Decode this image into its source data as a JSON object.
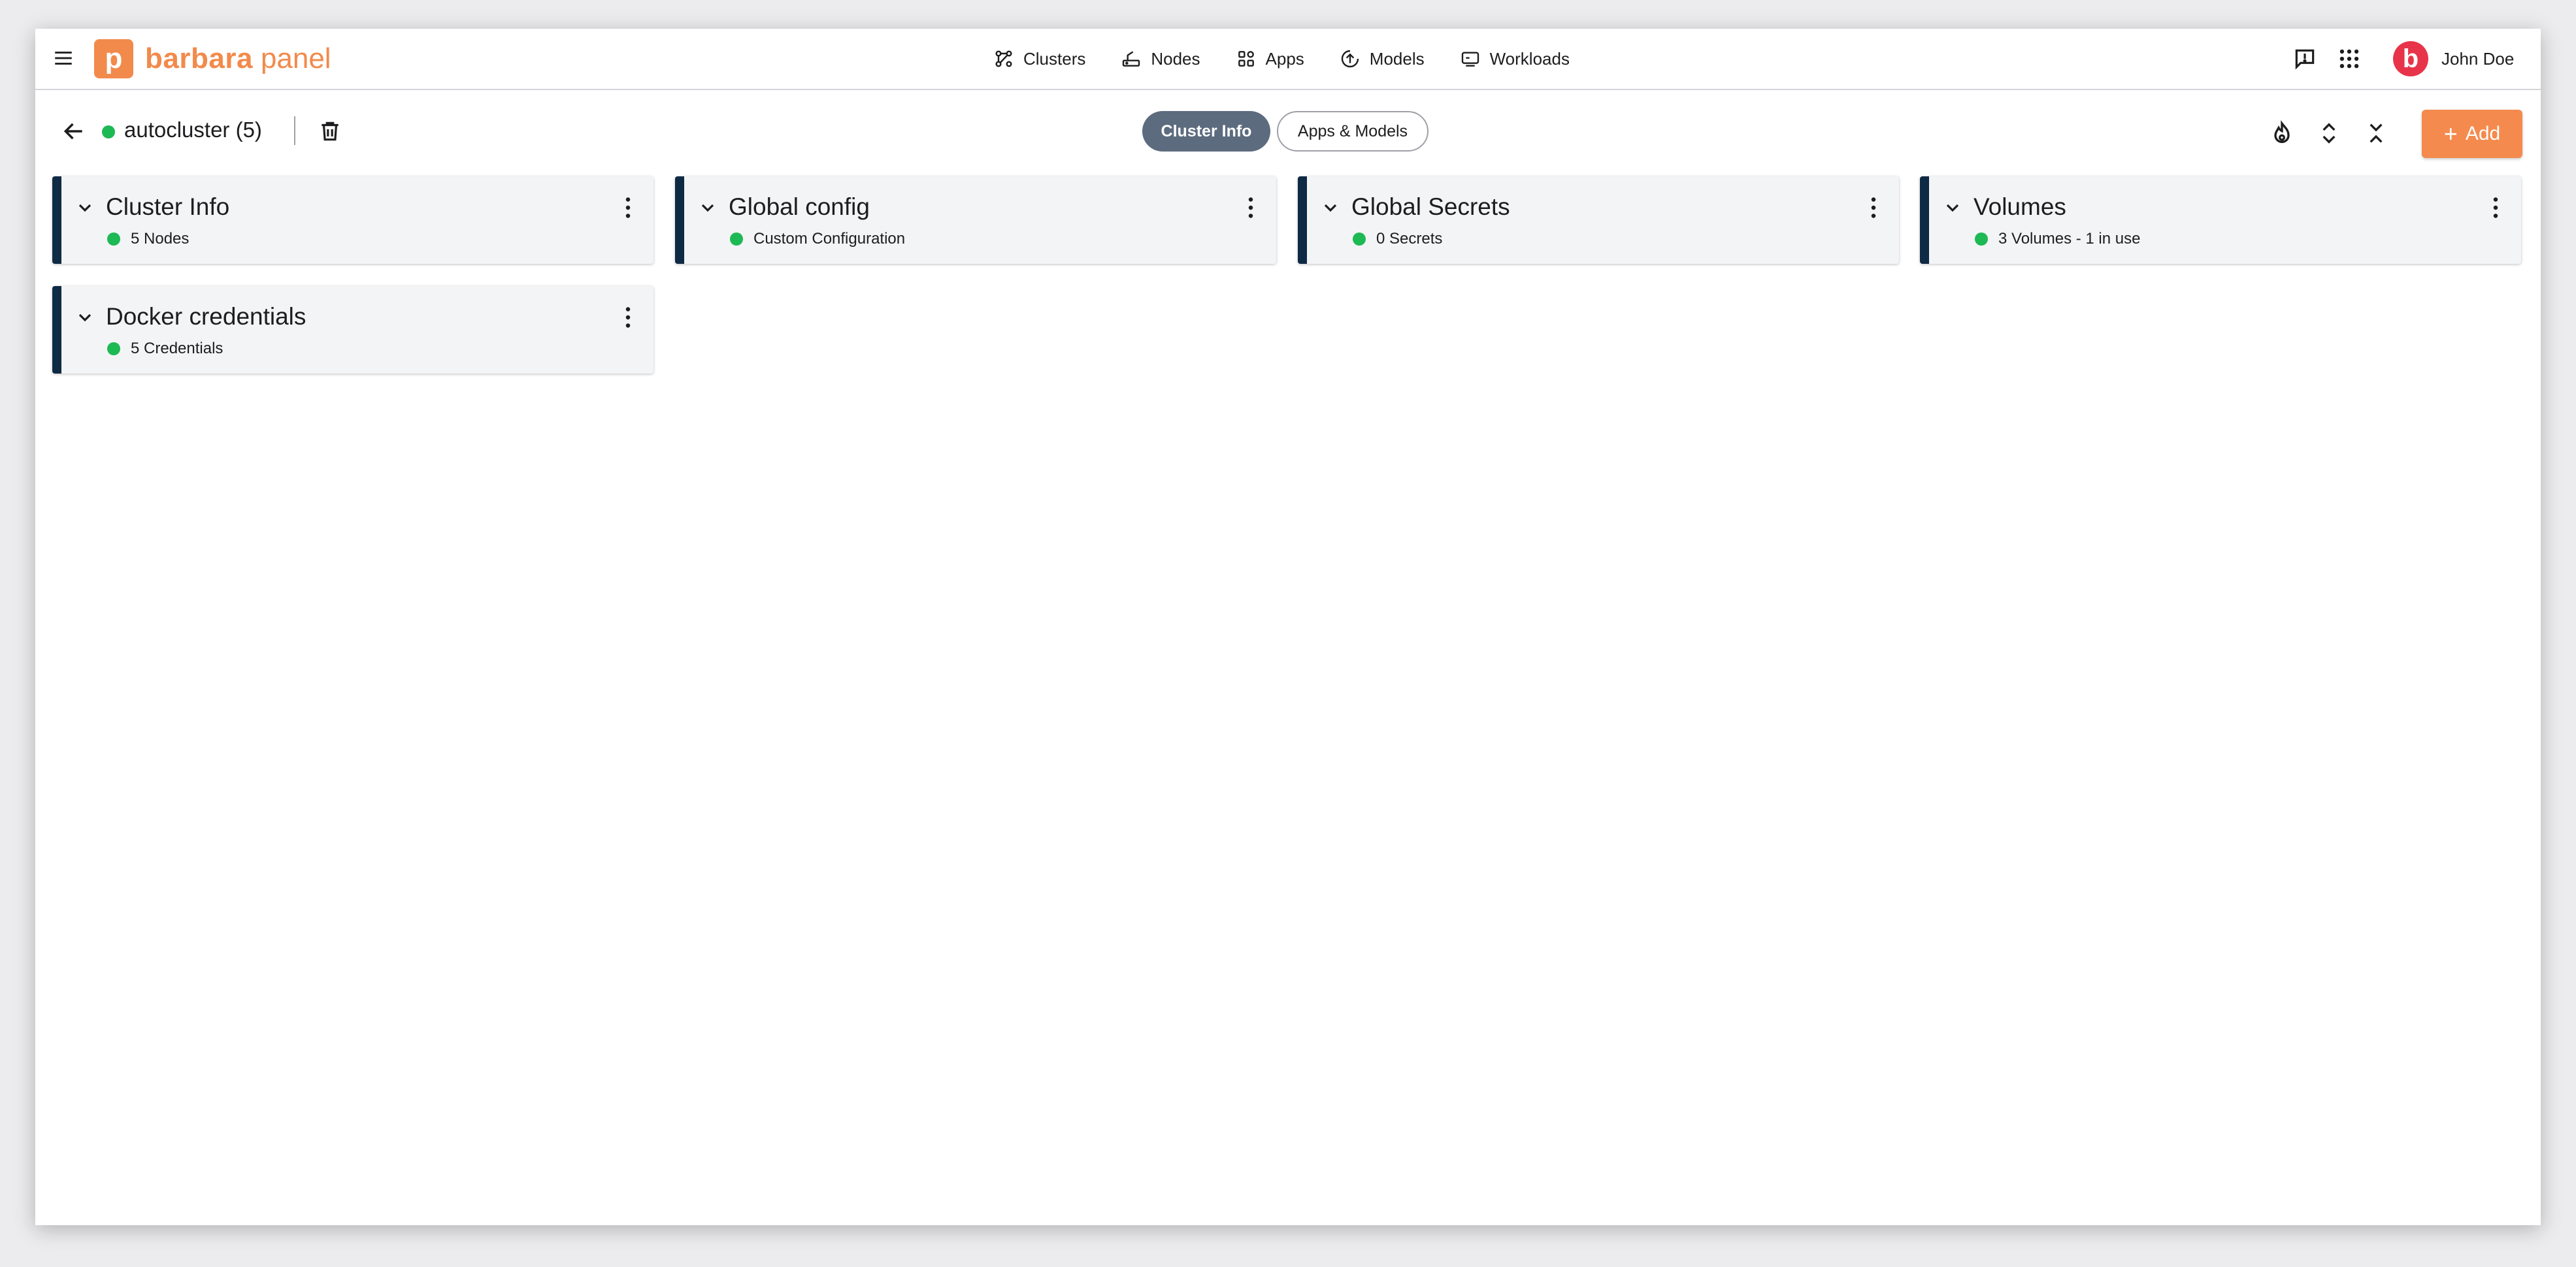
{
  "brand": {
    "logo_letter": "p",
    "word1": "barbara",
    "word2": "panel",
    "color": "#f28a4b"
  },
  "nav": {
    "items": [
      {
        "label": "Clusters",
        "icon": "clusters-icon"
      },
      {
        "label": "Nodes",
        "icon": "nodes-icon"
      },
      {
        "label": "Apps",
        "icon": "apps-icon"
      },
      {
        "label": "Models",
        "icon": "models-icon"
      },
      {
        "label": "Workloads",
        "icon": "workloads-icon"
      }
    ]
  },
  "user": {
    "avatar_letter": "b",
    "name": "John Doe",
    "avatar_color": "#e8344a"
  },
  "cluster": {
    "name": "autocluster (5)",
    "status_color": "#1db954"
  },
  "tabs": {
    "active": "Cluster Info",
    "inactive": "Apps & Models"
  },
  "actions": {
    "add_label": "Add",
    "add_color": "#f58a4e"
  },
  "cards": [
    {
      "title": "Cluster Info",
      "status": "5 Nodes"
    },
    {
      "title": "Global config",
      "status": "Custom Configuration"
    },
    {
      "title": "Global Secrets",
      "status": "0 Secrets"
    },
    {
      "title": "Volumes",
      "status": "3 Volumes - 1 in use"
    },
    {
      "title": "Docker credentials",
      "status": "5 Credentials"
    }
  ],
  "colors": {
    "card_accent": "#0f2a44",
    "card_bg": "#f3f4f6",
    "status_green": "#1db954",
    "tab_active_bg": "#5d6b7e"
  }
}
